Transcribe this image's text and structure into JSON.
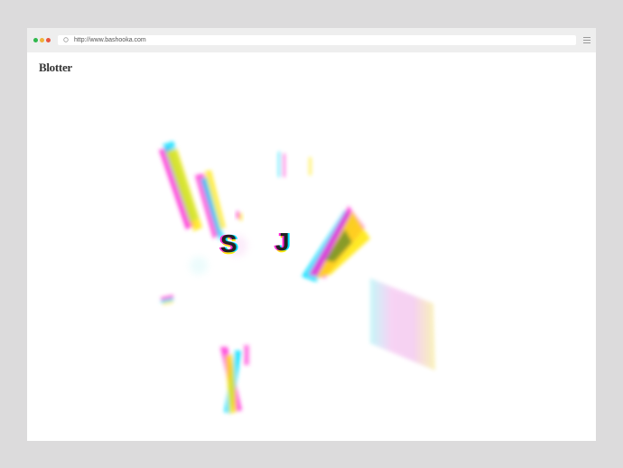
{
  "browser": {
    "url": "http://www.bashooka.com",
    "traffic_light_colors": [
      "#2fb84d",
      "#f0b13a",
      "#e8553f"
    ],
    "menu_icon": "hamburger-icon",
    "address_icon": "page-icon"
  },
  "page": {
    "logo_text": "Blotter",
    "letters": [
      "S",
      "J"
    ],
    "effect_colors": {
      "magenta": "#ff2bd6",
      "cyan": "#00e0ff",
      "yellow": "#ffe600"
    }
  }
}
